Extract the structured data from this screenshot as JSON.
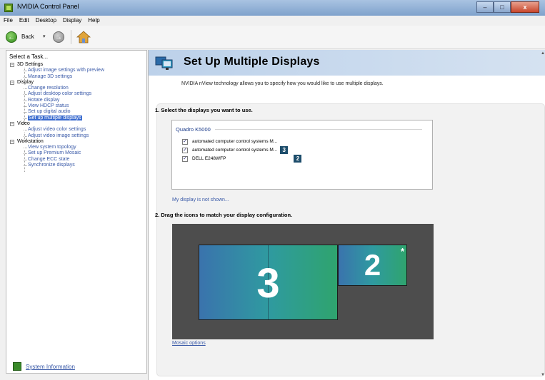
{
  "window": {
    "title": "NVIDIA Control Panel",
    "min_glyph": "–",
    "max_glyph": "□",
    "close_glyph": "x"
  },
  "menu": [
    "File",
    "Edit",
    "Desktop",
    "Display",
    "Help"
  ],
  "toolbar": {
    "back_label": "Back",
    "back_arrow": "▾"
  },
  "sidebar": {
    "title": "Select a Task...",
    "categories": [
      {
        "label": "3D Settings",
        "items": [
          "Adjust image settings with preview",
          "Manage 3D settings"
        ]
      },
      {
        "label": "Display",
        "items": [
          "Change resolution",
          "Adjust desktop color settings",
          "Rotate display",
          "View HDCP status",
          "Set up digital audio",
          "Set up multiple displays"
        ]
      },
      {
        "label": "Video",
        "items": [
          "Adjust video color settings",
          "Adjust video image settings"
        ]
      },
      {
        "label": "Workstation",
        "items": [
          "View system topology",
          "Set up Premium Mosaic",
          "Change ECC state",
          "Synchronize displays"
        ]
      }
    ],
    "selected": "Set up multiple displays",
    "system_info": "System Information"
  },
  "page": {
    "title": "Set Up Multiple Displays",
    "description": "NVIDIA nView technology allows you to specify how you would like to use multiple displays.",
    "section1": "1. Select the displays you want to use.",
    "gpu": "Quadro K5000",
    "displays": [
      {
        "name": "automated computer control systems M...",
        "checked": true,
        "badge": ""
      },
      {
        "name": "automated computer control systems M...",
        "checked": true,
        "badge": "3"
      },
      {
        "name": "DELL E248WFP",
        "checked": true,
        "badge": "2"
      }
    ],
    "not_shown_link": "My display is not shown...",
    "section2": "2. Drag the icons to match your display configuration.",
    "monitors": [
      {
        "number": "3",
        "primary": false
      },
      {
        "number": "2",
        "primary": true,
        "marker": "*"
      }
    ],
    "mosaic_link": "Mosaic options"
  },
  "colors": {
    "accent": "#3a6bcf",
    "link": "#3a5aa8",
    "badge": "#1d4d6b",
    "canvas": "#4d4d4d"
  },
  "icons": [
    "nvidia-app-icon",
    "back-arrow-icon",
    "forward-arrow-icon",
    "home-icon",
    "multiple-displays-icon",
    "system-info-icon"
  ]
}
